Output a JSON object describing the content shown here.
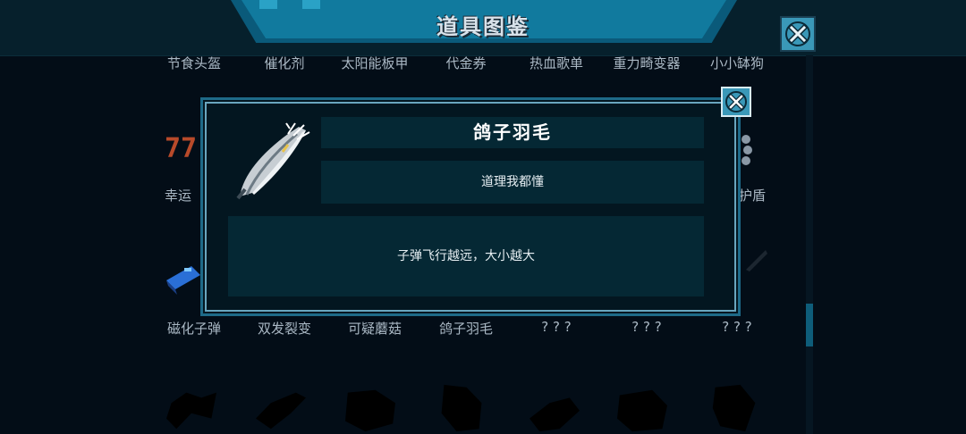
{
  "header": {
    "title": "道具图鉴"
  },
  "grid": {
    "row1": [
      "节食头盔",
      "催化剂",
      "太阳能板甲",
      "代金券",
      "热血歌单",
      "重力畸变器",
      "小小缽狗"
    ],
    "row2": [
      "幸运",
      "护盾"
    ],
    "row3": [
      "磁化子弹",
      "双发裂变",
      "可疑蘑菇",
      "鸽子羽毛",
      "? ? ?",
      "? ? ?",
      "? ? ?"
    ]
  },
  "detail": {
    "name": "鸽子羽毛",
    "subtitle": "道理我都懂",
    "description": "子弹飞行越远，大小越大"
  },
  "colors": {
    "accent": "#3a98b8",
    "panel": "#052834",
    "background": "#030d17"
  },
  "icons": [
    "close-icon",
    "feather-icon"
  ]
}
